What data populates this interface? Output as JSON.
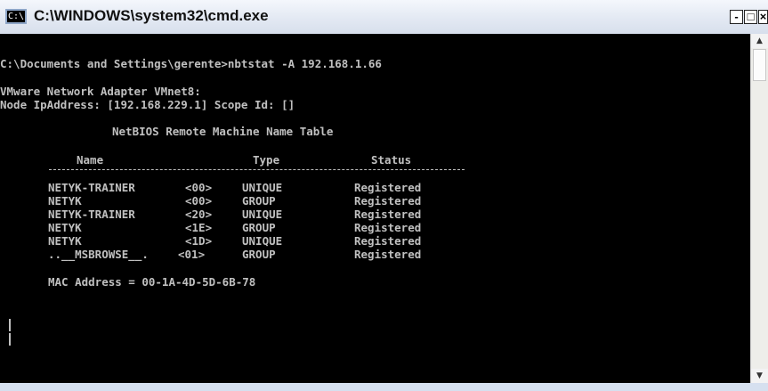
{
  "window": {
    "title": "C:\\WINDOWS\\system32\\cmd.exe",
    "icon_text": "C:\\",
    "controls": {
      "minimize": "-",
      "maximize": "□",
      "close": "×"
    }
  },
  "console": {
    "command_line": "C:\\Documents and Settings\\gerente>nbtstat -A 192.168.1.66",
    "adapter_line": "VMware Network Adapter VMnet8:",
    "node_line": "Node IpAddress: [192.168.229.1] Scope Id: []",
    "table_title": "NetBIOS Remote Machine Name Table",
    "headers": {
      "name": "Name",
      "type": "Type",
      "status": "Status"
    },
    "rows": [
      {
        "name": "NETYK-TRAINER",
        "code": "<00>",
        "type": "UNIQUE",
        "status": "Registered"
      },
      {
        "name": "NETYK",
        "code": "<00>",
        "type": "GROUP",
        "status": "Registered"
      },
      {
        "name": "NETYK-TRAINER",
        "code": "<20>",
        "type": "UNIQUE",
        "status": "Registered"
      },
      {
        "name": "NETYK",
        "code": "<1E>",
        "type": "GROUP",
        "status": "Registered"
      },
      {
        "name": "NETYK",
        "code": "<1D>",
        "type": "UNIQUE",
        "status": "Registered"
      },
      {
        "name": "..__MSBROWSE__.",
        "code": "<01>",
        "type": "GROUP",
        "status": "Registered"
      }
    ],
    "mac_line": "MAC Address = 00-1A-4D-5D-6B-78"
  },
  "scrollbar": {
    "up_icon": "arrow-up-icon",
    "down_icon": "arrow-down-icon"
  }
}
